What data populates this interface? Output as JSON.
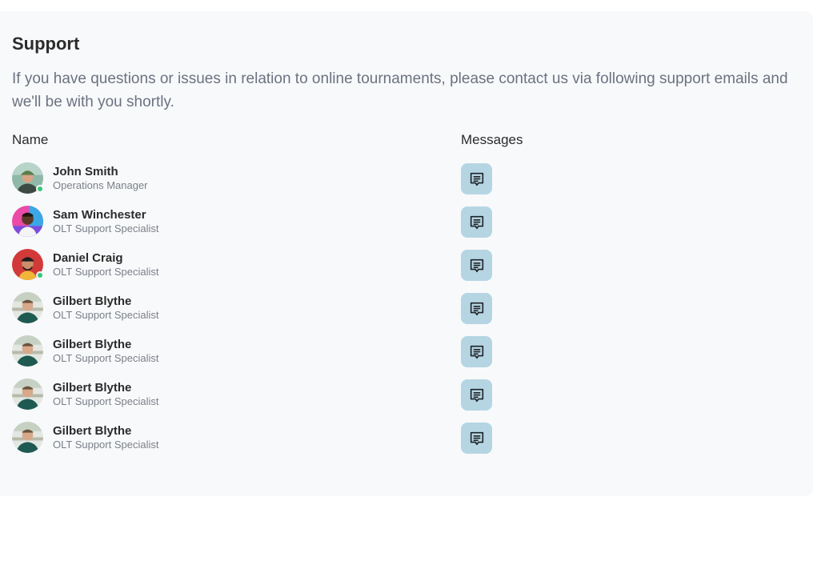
{
  "support": {
    "title": "Support",
    "description": "If you have questions or issues in relation to online tournaments, please contact us via following support emails and we'll be with you shortly.",
    "columns": {
      "name": "Name",
      "messages": "Messages"
    },
    "contacts": [
      {
        "name": "John Smith",
        "role": "Operations Manager",
        "online": true,
        "avatar": "green-cap-man"
      },
      {
        "name": "Sam Winchester",
        "role": "OLT Support Specialist",
        "online": false,
        "avatar": "colorful-man"
      },
      {
        "name": "Daniel Craig",
        "role": "OLT Support Specialist",
        "online": true,
        "avatar": "red-cap-man"
      },
      {
        "name": "Gilbert Blythe",
        "role": "OLT Support Specialist",
        "online": false,
        "avatar": "green-shirt-man"
      },
      {
        "name": "Gilbert Blythe",
        "role": "OLT Support Specialist",
        "online": false,
        "avatar": "green-shirt-man"
      },
      {
        "name": "Gilbert Blythe",
        "role": "OLT Support Specialist",
        "online": false,
        "avatar": "green-shirt-man"
      },
      {
        "name": "Gilbert Blythe",
        "role": "OLT Support Specialist",
        "online": false,
        "avatar": "green-shirt-man"
      }
    ],
    "message_icon": "chat-message-icon",
    "colors": {
      "panel_bg": "#f8f9fb",
      "message_button_bg": "#b5d5e3",
      "online_status": "#34c77b"
    }
  }
}
